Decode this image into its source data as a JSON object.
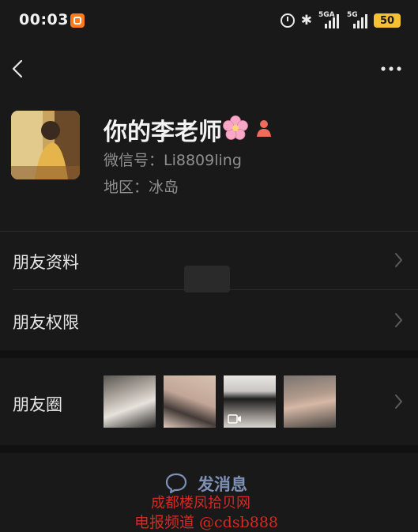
{
  "status_bar": {
    "time": "00:03",
    "network_1": "5GA",
    "network_2": "5G",
    "battery": "50"
  },
  "profile": {
    "nickname": "你的李老师",
    "wechat_id": "微信号：Li8809ling",
    "region": "地区：冰岛"
  },
  "menu": {
    "friend_profile": "朋友资料",
    "friend_permissions": "朋友权限",
    "moments": "朋友圈"
  },
  "actions": {
    "send_message": "发消息"
  },
  "watermark": {
    "line1": "成都楼凤拾贝网",
    "line2": "电报频道 @cdsb888"
  },
  "colors": {
    "background": "#191919",
    "link_blue": "#7d90b5",
    "battery": "#f3c132",
    "watermark_red": "#d42a22"
  }
}
